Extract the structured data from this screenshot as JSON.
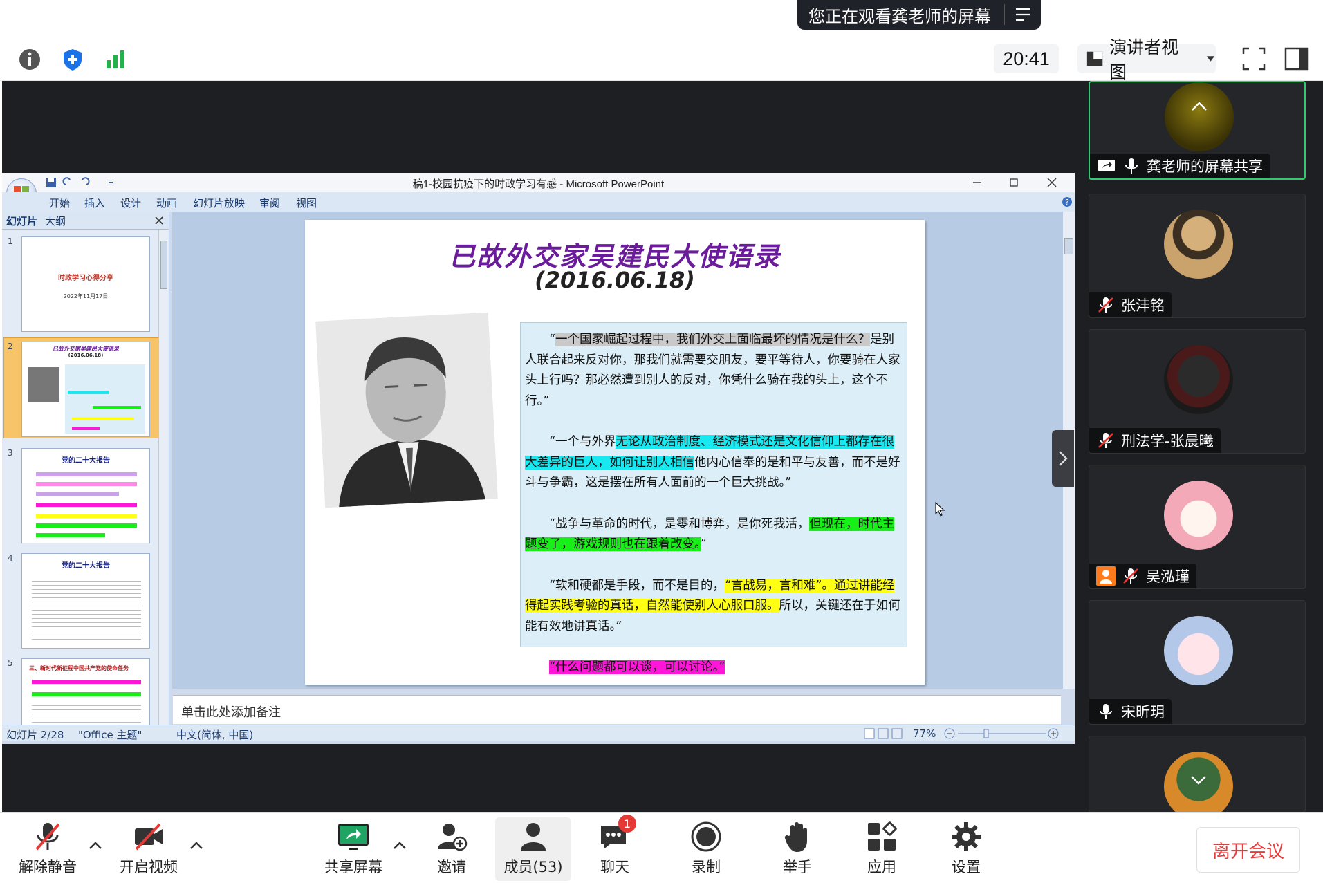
{
  "share_banner": {
    "text": "您正在观看龚老师的屏幕"
  },
  "top": {
    "clock": "20:41",
    "view_mode": "演讲者视图"
  },
  "ppt": {
    "window_title": "稿1-校园抗疫下的时政学习有感 - Microsoft PowerPoint",
    "menu": [
      "开始",
      "插入",
      "设计",
      "动画",
      "幻灯片放映",
      "审阅",
      "视图"
    ],
    "panel_tabs": [
      "幻灯片",
      "大纲"
    ],
    "thumbs": [
      {
        "num": "1",
        "title": "时政学习心得分享",
        "sub": "2022年11月17日"
      },
      {
        "num": "2",
        "title": "已故外交家吴建民大使语录",
        "sub": "(2016.06.18)"
      },
      {
        "num": "3",
        "title": "党的二十大报告",
        "sub": ""
      },
      {
        "num": "4",
        "title": "党的二十大报告",
        "sub": ""
      },
      {
        "num": "5",
        "title": "三、新时代新征程中国共产党的使命任务",
        "sub": ""
      }
    ],
    "notes_placeholder": "单击此处添加备注",
    "status": {
      "slide": "幻灯片 2/28",
      "theme": "\"Office 主题\"",
      "lang": "中文(简体, 中国)",
      "zoom": "77%"
    }
  },
  "slide": {
    "title": "已故外交家吴建民大使语录",
    "date": "(2016.06.18)",
    "q1_a": "“",
    "q1_hl": "一个国家崛起过程中，我们外交上面临最坏的情况是什么？",
    "q1_b": "是别人联合起来反对你，那我们就需要交朋友，要平等待人，你要骑在人家头上行吗？那必然遭到别人的反对，你凭什么骑在我的头上，这个不行。”",
    "q2_a": "“一个与外界",
    "q2_hl": "无论从政治制度、经济模式还是文化信仰上都存在很大差异的巨人，如何让别人相信",
    "q2_b": "他内心信奉的是和平与友善，而不是好斗与争霸，这是摆在所有人面前的一个巨大挑战。”",
    "q3_a": "“战争与革命的时代，是零和博弈，是你死我活，",
    "q3_hl": "但现在，时代主题变了，游戏规则也在跟着改变。",
    "q3_b": "”",
    "q4_a": "“软和硬都是手段，而不是目的，",
    "q4_hl1": "“言战易，言和难”。通过讲能经得起实践考验的真话，自然能使别人心服口服。",
    "q4_b": "所以，关键还在于如何能有效地讲真话。”",
    "q5_hl": "“什么问题都可以谈，可以讨论。”"
  },
  "participants": [
    {
      "name": "龚老师的屏幕共享"
    },
    {
      "name": "张沣铭"
    },
    {
      "name": "刑法学-张晨曦"
    },
    {
      "name": "吴泓瑾"
    },
    {
      "name": "宋昕玥"
    },
    {
      "name": ""
    }
  ],
  "bottom": {
    "unmute": "解除静音",
    "video": "开启视频",
    "share": "共享屏幕",
    "invite": "邀请",
    "members": "成员(53)",
    "chat": "聊天",
    "chat_badge": "1",
    "record": "录制",
    "raise": "举手",
    "apps": "应用",
    "settings": "设置",
    "leave": "离开会议"
  }
}
